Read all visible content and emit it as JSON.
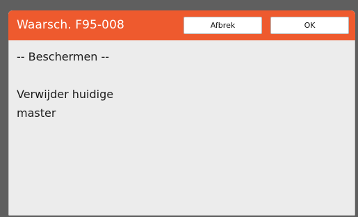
{
  "dialog": {
    "title": "Waarsch. F95-008",
    "cancel_label": "Afbrek",
    "ok_label": "OK",
    "heading": "-- Beschermen --",
    "message_lines": [
      "Verwijder huidige",
      "master"
    ]
  },
  "colors": {
    "titlebar": "#ee5a2e",
    "dialog_background": "#ececec",
    "frame": "#5f5f5f"
  }
}
